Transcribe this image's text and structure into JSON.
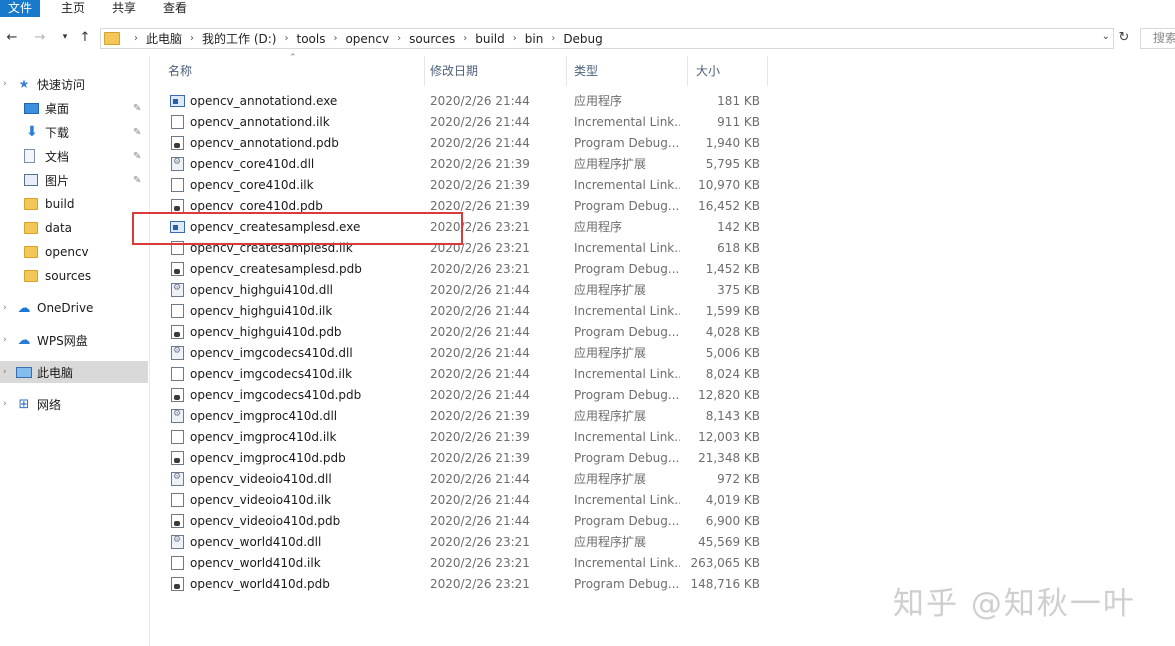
{
  "ribbon": {
    "tabs": [
      "文件",
      "主页",
      "共享",
      "查看"
    ]
  },
  "nav": {
    "back_icon": "arrow-left-icon",
    "forward_icon": "arrow-right-icon",
    "recent_icon": "chevron-down-icon",
    "up_icon": "arrow-up-icon",
    "breadcrumbs": [
      "此电脑",
      "我的工作 (D:)",
      "tools",
      "opencv",
      "sources",
      "build",
      "bin",
      "Debug"
    ],
    "search_placeholder": "搜索"
  },
  "sidebar": {
    "items": [
      {
        "label": "快速访问",
        "icon": "star-icon",
        "pinned": false
      },
      {
        "label": "桌面",
        "icon": "desktop-icon",
        "pinned": true
      },
      {
        "label": "下载",
        "icon": "download-icon",
        "pinned": true
      },
      {
        "label": "文档",
        "icon": "document-icon",
        "pinned": true
      },
      {
        "label": "图片",
        "icon": "pictures-icon",
        "pinned": true
      },
      {
        "label": "build",
        "icon": "folder-icon",
        "pinned": false
      },
      {
        "label": "data",
        "icon": "folder-icon",
        "pinned": false
      },
      {
        "label": "opencv",
        "icon": "folder-icon",
        "pinned": false
      },
      {
        "label": "sources",
        "icon": "folder-icon",
        "pinned": false
      },
      {
        "label": "OneDrive",
        "icon": "cloud-icon",
        "pinned": false
      },
      {
        "label": "WPS网盘",
        "icon": "wps-cloud-icon",
        "pinned": false
      },
      {
        "label": "此电脑",
        "icon": "computer-icon",
        "pinned": false,
        "selected": true
      },
      {
        "label": "网络",
        "icon": "network-icon",
        "pinned": false
      }
    ]
  },
  "columns": {
    "name": "名称",
    "date": "修改日期",
    "type": "类型",
    "size": "大小"
  },
  "files": [
    {
      "name": "opencv_annotationd.exe",
      "date": "2020/2/26 21:44",
      "type": "应用程序",
      "size": "181 KB",
      "kind": "exe"
    },
    {
      "name": "opencv_annotationd.ilk",
      "date": "2020/2/26 21:44",
      "type": "Incremental Link...",
      "size": "911 KB",
      "kind": "ilk"
    },
    {
      "name": "opencv_annotationd.pdb",
      "date": "2020/2/26 21:44",
      "type": "Program Debug...",
      "size": "1,940 KB",
      "kind": "pdb"
    },
    {
      "name": "opencv_core410d.dll",
      "date": "2020/2/26 21:39",
      "type": "应用程序扩展",
      "size": "5,795 KB",
      "kind": "dll"
    },
    {
      "name": "opencv_core410d.ilk",
      "date": "2020/2/26 21:39",
      "type": "Incremental Link...",
      "size": "10,970 KB",
      "kind": "ilk"
    },
    {
      "name": "opencv_core410d.pdb",
      "date": "2020/2/26 21:39",
      "type": "Program Debug...",
      "size": "16,452 KB",
      "kind": "pdb"
    },
    {
      "name": "opencv_createsamplesd.exe",
      "date": "2020/2/26 23:21",
      "type": "应用程序",
      "size": "142 KB",
      "kind": "exe"
    },
    {
      "name": "opencv_createsamplesd.ilk",
      "date": "2020/2/26 23:21",
      "type": "Incremental Link...",
      "size": "618 KB",
      "kind": "ilk"
    },
    {
      "name": "opencv_createsamplesd.pdb",
      "date": "2020/2/26 23:21",
      "type": "Program Debug...",
      "size": "1,452 KB",
      "kind": "pdb"
    },
    {
      "name": "opencv_highgui410d.dll",
      "date": "2020/2/26 21:44",
      "type": "应用程序扩展",
      "size": "375 KB",
      "kind": "dll"
    },
    {
      "name": "opencv_highgui410d.ilk",
      "date": "2020/2/26 21:44",
      "type": "Incremental Link...",
      "size": "1,599 KB",
      "kind": "ilk"
    },
    {
      "name": "opencv_highgui410d.pdb",
      "date": "2020/2/26 21:44",
      "type": "Program Debug...",
      "size": "4,028 KB",
      "kind": "pdb"
    },
    {
      "name": "opencv_imgcodecs410d.dll",
      "date": "2020/2/26 21:44",
      "type": "应用程序扩展",
      "size": "5,006 KB",
      "kind": "dll"
    },
    {
      "name": "opencv_imgcodecs410d.ilk",
      "date": "2020/2/26 21:44",
      "type": "Incremental Link...",
      "size": "8,024 KB",
      "kind": "ilk"
    },
    {
      "name": "opencv_imgcodecs410d.pdb",
      "date": "2020/2/26 21:44",
      "type": "Program Debug...",
      "size": "12,820 KB",
      "kind": "pdb"
    },
    {
      "name": "opencv_imgproc410d.dll",
      "date": "2020/2/26 21:39",
      "type": "应用程序扩展",
      "size": "8,143 KB",
      "kind": "dll"
    },
    {
      "name": "opencv_imgproc410d.ilk",
      "date": "2020/2/26 21:39",
      "type": "Incremental Link...",
      "size": "12,003 KB",
      "kind": "ilk"
    },
    {
      "name": "opencv_imgproc410d.pdb",
      "date": "2020/2/26 21:39",
      "type": "Program Debug...",
      "size": "21,348 KB",
      "kind": "pdb"
    },
    {
      "name": "opencv_videoio410d.dll",
      "date": "2020/2/26 21:44",
      "type": "应用程序扩展",
      "size": "972 KB",
      "kind": "dll"
    },
    {
      "name": "opencv_videoio410d.ilk",
      "date": "2020/2/26 21:44",
      "type": "Incremental Link...",
      "size": "4,019 KB",
      "kind": "ilk"
    },
    {
      "name": "opencv_videoio410d.pdb",
      "date": "2020/2/26 21:44",
      "type": "Program Debug...",
      "size": "6,900 KB",
      "kind": "pdb"
    },
    {
      "name": "opencv_world410d.dll",
      "date": "2020/2/26 23:21",
      "type": "应用程序扩展",
      "size": "45,569 KB",
      "kind": "dll"
    },
    {
      "name": "opencv_world410d.ilk",
      "date": "2020/2/26 23:21",
      "type": "Incremental Link...",
      "size": "263,065 KB",
      "kind": "ilk"
    },
    {
      "name": "opencv_world410d.pdb",
      "date": "2020/2/26 23:21",
      "type": "Program Debug...",
      "size": "148,716 KB",
      "kind": "pdb"
    }
  ],
  "watermark": "知乎 @知秋一叶",
  "colors": {
    "file_tab": "#1979ca",
    "highlight": "#d93a3a",
    "selected_sidebar": "#d9d9d9"
  }
}
